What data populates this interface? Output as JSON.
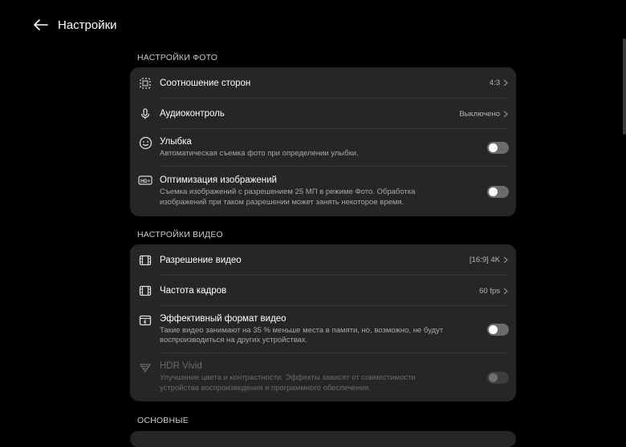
{
  "header": {
    "title": "Настройки"
  },
  "photo": {
    "section_label": "НАСТРОЙКИ ФОТО",
    "aspect": {
      "title": "Соотношение сторон",
      "value": "4:3"
    },
    "audio": {
      "title": "Аудиоконтроль",
      "value": "Выключено"
    },
    "smile": {
      "title": "Улыбка",
      "subtitle": "Автоматическая съемка фото при определении улыбки.",
      "enabled": false
    },
    "optimize": {
      "title": "Оптимизация изображений",
      "subtitle": "Съемка изображений с разрешением 25 МП в режиме Фото. Обработка изображений при таком разрешении может занять некоторое время.",
      "enabled": false
    }
  },
  "video": {
    "section_label": "НАСТРОЙКИ ВИДЕО",
    "resolution": {
      "title": "Разрешение видео",
      "value": "[16:9] 4K"
    },
    "framerate": {
      "title": "Частота кадров",
      "value": "60 fps"
    },
    "efficient": {
      "title": "Эффективный формат видео",
      "subtitle": "Такие видео занимают на 35 % меньше места в памяти, но, возможно, не будут воспроизводиться на других устройствах.",
      "enabled": false
    },
    "hdr": {
      "title": "HDR Vivid",
      "subtitle": "Улучшение цвета и контрастности. Эффекты зависят от совместимости устройства воспроизведения и программного обеспечения.",
      "enabled": false,
      "disabled": true
    }
  },
  "general": {
    "section_label": "ОСНОВНЫЕ"
  }
}
